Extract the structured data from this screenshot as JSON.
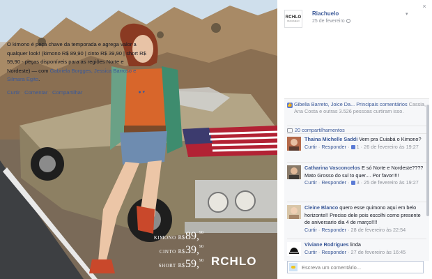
{
  "photo": {
    "prices": [
      {
        "label": "KIMONO",
        "currency": "R$",
        "amount": "89,",
        "cents": "90"
      },
      {
        "label": "CINTO",
        "currency": "R$",
        "amount": "39,",
        "cents": "90"
      },
      {
        "label": "SHORT",
        "currency": "R$",
        "amount": "59,",
        "cents": "90"
      }
    ],
    "brand": "RCHLO"
  },
  "post": {
    "avatar_logo": "RCHLO",
    "avatar_sub": "RIACHUELO",
    "page_name": "Riachuelo",
    "date": "25 de fevereiro",
    "text_before": "O kimono é peça chave da temporada e agrega valor a qualquer look! (kimono R$ 89,90 | cinto R$ 39,90 | short R$ 59,90 - peças disponíveis para as regiões Norte e Nordeste) — com ",
    "tagged": "Gabriela Borgges, Jessica Barroso e Silmara Egito",
    "text_after": ".",
    "actions": {
      "like": "Curtir",
      "comment": "Comentar",
      "share": "Compartilhar"
    },
    "likes_text_links": "Gibelia Barreto, Joice Da...",
    "likes_tab": "Principais comentários",
    "likes_text_rest": "Cassia, Ana Costa e outras 3.526 pessoas curtiram isso.",
    "shares": "20 compartilhamentos"
  },
  "comments": [
    {
      "author": "Thaina Michelle Saddi",
      "text": "Vem pra Cuiabá o Kimono?",
      "like": "Curtir",
      "reply": "Responder",
      "likes": "1",
      "date": "26 de fevereiro às 19:27"
    },
    {
      "author": "Catharina Vasconcelos",
      "text": "E só Norte e Nordeste???? Mato Grosso do sul to quer.... Por favor!!!!",
      "like": "Curtir",
      "reply": "Responder",
      "likes": "3",
      "date": "25 de fevereiro às 19:27"
    },
    {
      "author": "Cleine Blanco",
      "text": "quero esse quimono aqui em belo horizonte!! Preciso dele pois escolhi como presente de aniversario dia 4 de março!!!!",
      "like": "Curtir",
      "reply": "Responder",
      "likes": "",
      "date": "28 de fevereiro às 22:54"
    },
    {
      "author": "Viviane Rodrigues",
      "text": "linda",
      "like": "Curtir",
      "reply": "Responder",
      "likes": "",
      "date": "27 de fevereiro às 16:45"
    }
  ],
  "write_placeholder": "Escreva um comentário...",
  "colors": {
    "link": "#3b5998",
    "meta": "#90949c",
    "feedback_bg": "#f6f7f9"
  }
}
